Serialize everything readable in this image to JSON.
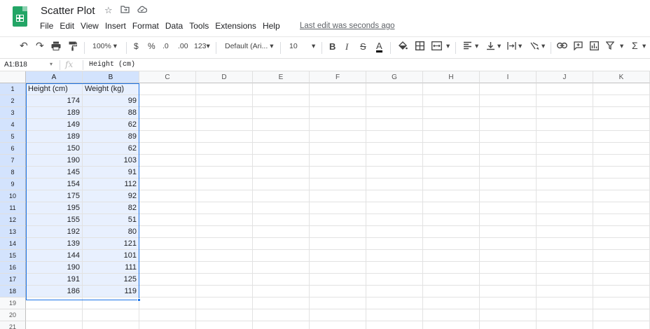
{
  "app": {
    "title": "Scatter Plot",
    "brand_color": "#23a566",
    "icons": [
      "star-icon",
      "move-to-folder-icon",
      "cloud-status-icon"
    ]
  },
  "menu": {
    "items": [
      "File",
      "Edit",
      "View",
      "Insert",
      "Format",
      "Data",
      "Tools",
      "Extensions",
      "Help"
    ],
    "last_edit": "Last edit was seconds ago"
  },
  "toolbar": {
    "zoom": "100%",
    "currency": "$",
    "percent": "%",
    "decrease_decimals": ".0",
    "increase_decimals": ".00",
    "more_formats": "123",
    "font": "Default (Ari...",
    "font_size": "10",
    "bold": "B",
    "italic": "I",
    "strikethrough": "S",
    "text_color": "A"
  },
  "formula_bar": {
    "name_box": "A1:B18",
    "fx": "fx",
    "content": "Height (cm)"
  },
  "sheet": {
    "columns": [
      "A",
      "B",
      "C",
      "D",
      "E",
      "F",
      "G",
      "H",
      "I",
      "J",
      "K"
    ],
    "rows": [
      "1",
      "2",
      "3",
      "4",
      "5",
      "6",
      "7",
      "8",
      "9",
      "10",
      "11",
      "12",
      "13",
      "14",
      "15",
      "16",
      "17",
      "18",
      "19",
      "20",
      "21"
    ],
    "header_row": [
      "Height (cm)",
      "Weight (kg)"
    ],
    "data": [
      [
        "174",
        "99"
      ],
      [
        "189",
        "88"
      ],
      [
        "149",
        "62"
      ],
      [
        "189",
        "89"
      ],
      [
        "150",
        "62"
      ],
      [
        "190",
        "103"
      ],
      [
        "145",
        "91"
      ],
      [
        "154",
        "112"
      ],
      [
        "175",
        "92"
      ],
      [
        "195",
        "82"
      ],
      [
        "155",
        "51"
      ],
      [
        "192",
        "80"
      ],
      [
        "139",
        "121"
      ],
      [
        "144",
        "101"
      ],
      [
        "190",
        "111"
      ],
      [
        "191",
        "125"
      ],
      [
        "186",
        "119"
      ]
    ],
    "selection_color": "#1a73e8"
  }
}
